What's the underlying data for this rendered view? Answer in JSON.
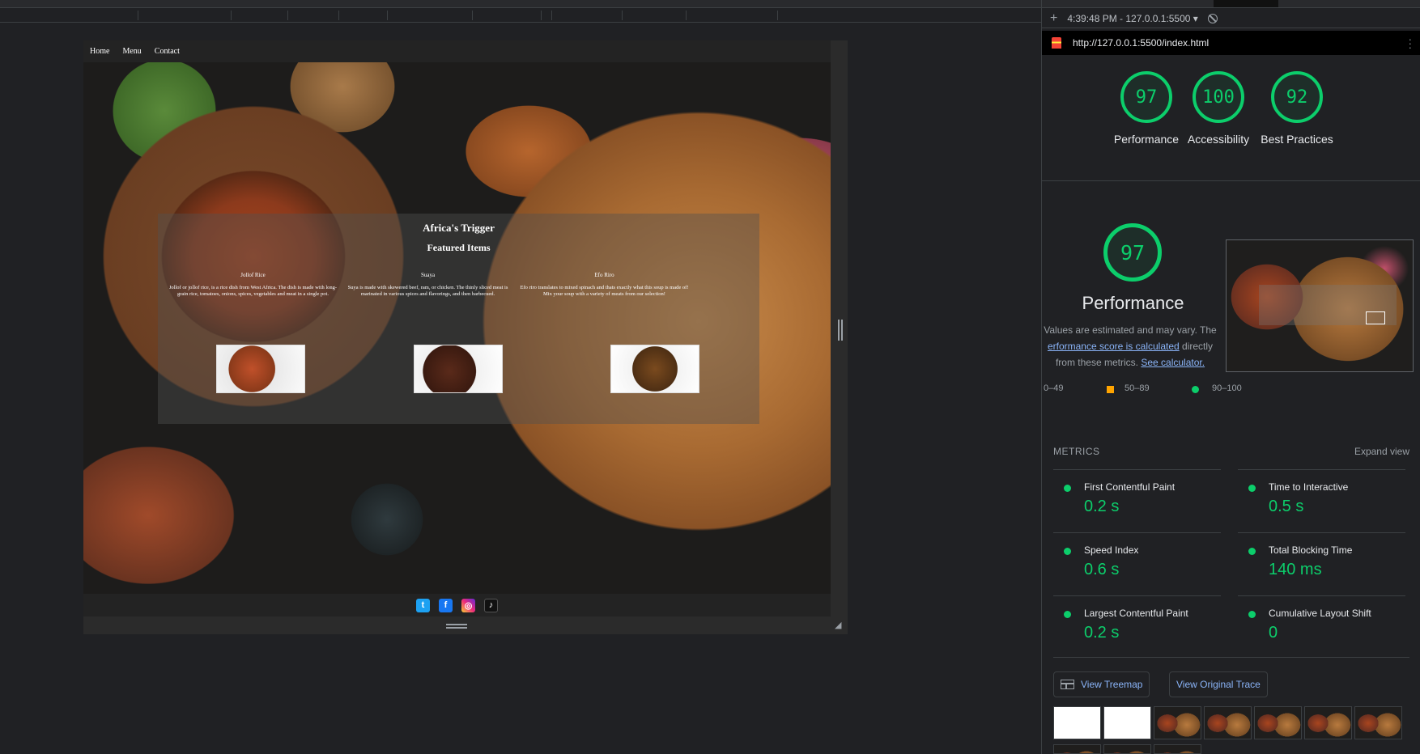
{
  "site": {
    "nav": [
      "Home",
      "Menu",
      "Contact"
    ],
    "title": "Africa's Trigger",
    "subtitle": "Featured Items",
    "items": [
      {
        "name": "Jollof Rice",
        "desc": "Jollof or jollof rice, is a rice dish from West Africa. The dish is made with long-grain rice, tomatoes, onions, spices, vegetables and meat in a single pot."
      },
      {
        "name": "Suaya",
        "desc": "Suya is made with skewered beef, ram, or chicken. The thinly sliced meat is marinated in various spices and flavorings, and then barbecued."
      },
      {
        "name": "Efo Riro",
        "desc": "Efo riro translates to mixed spinach and thats exactly what this soup is made of! Mix your soup with a variety of meats from our selection!"
      }
    ],
    "social": [
      {
        "icon": "twitter-icon",
        "glyph": "t"
      },
      {
        "icon": "facebook-icon",
        "glyph": "f"
      },
      {
        "icon": "instagram-icon",
        "glyph": "◎"
      },
      {
        "icon": "tiktok-icon",
        "glyph": "♪"
      }
    ]
  },
  "lighthouse": {
    "report_time": "4:39:48 PM - 127.0.0.1:5500 ▾",
    "url": "http://127.0.0.1:5500/index.html",
    "scores": [
      {
        "value": "97",
        "label": "Performance"
      },
      {
        "value": "100",
        "label": "Accessibility"
      },
      {
        "value": "92",
        "label": "Best Practices"
      }
    ],
    "performance": {
      "score": "97",
      "title": "Performance",
      "note_pre": "Values are estimated and may vary. The",
      "note_link": "erformance score is calculated",
      "note_mid": "directly from",
      "note_post": "these metrics.",
      "note_calc": "See calculator."
    },
    "legend": [
      "0–49",
      "50–89",
      "90–100"
    ],
    "metrics_title": "METRICS",
    "expand_view": "Expand view",
    "metrics": [
      {
        "name": "First Contentful Paint",
        "value": "0.2 s"
      },
      {
        "name": "Time to Interactive",
        "value": "0.5 s"
      },
      {
        "name": "Speed Index",
        "value": "0.6 s"
      },
      {
        "name": "Total Blocking Time",
        "value": "140 ms"
      },
      {
        "name": "Largest Contentful Paint",
        "value": "0.2 s"
      },
      {
        "name": "Cumulative Layout Shift",
        "value": "0"
      }
    ],
    "buttons": {
      "treemap": "View Treemap",
      "trace": "View Original Trace"
    },
    "colors": {
      "pass": "#0cce6b",
      "average": "#ffa400",
      "link": "#8ab4f8"
    }
  }
}
